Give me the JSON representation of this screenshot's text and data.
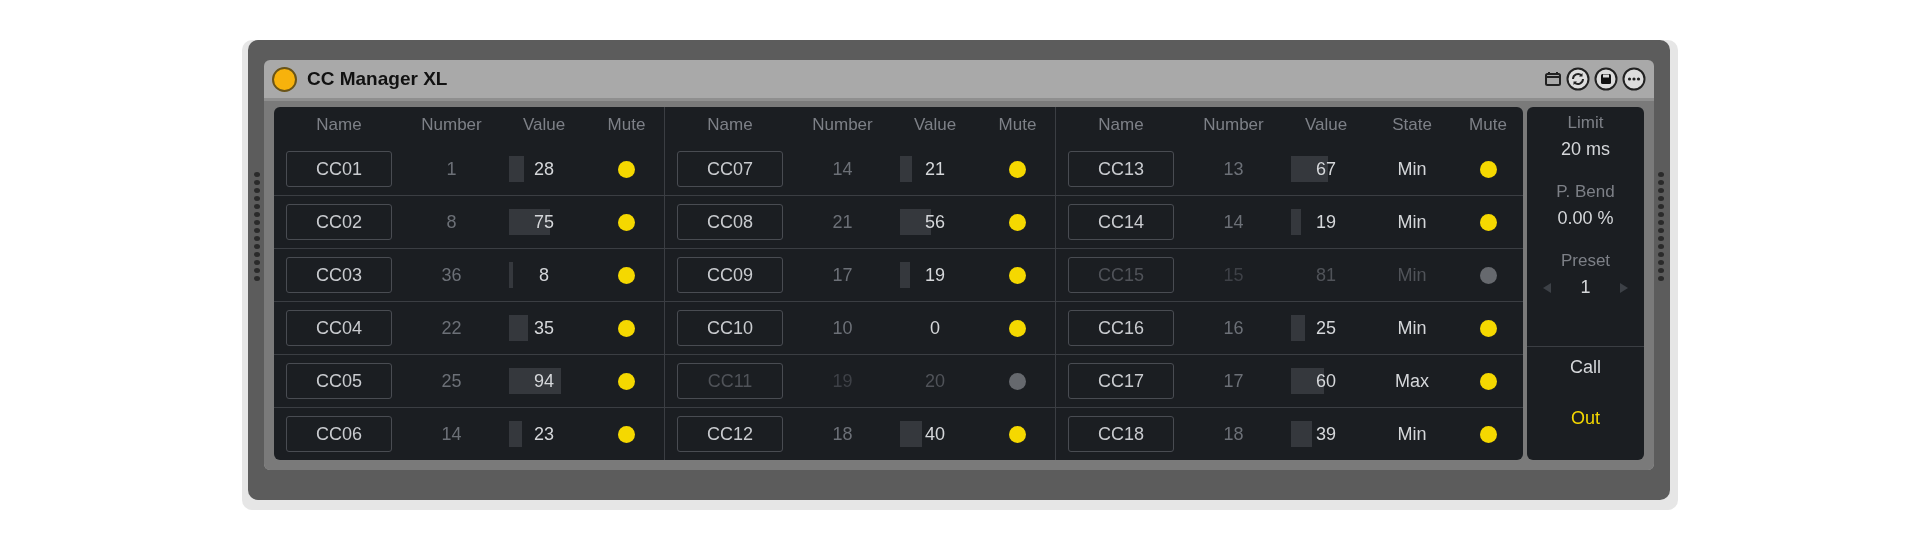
{
  "window": {
    "title": "CC Manager XL",
    "power_on": true
  },
  "sections": [
    {
      "columns": [
        "Name",
        "Number",
        "Value",
        "Mute"
      ],
      "rows": [
        {
          "name": "CC01",
          "number": "1",
          "value": "28",
          "active": true
        },
        {
          "name": "CC02",
          "number": "8",
          "value": "75",
          "active": true
        },
        {
          "name": "CC03",
          "number": "36",
          "value": "8",
          "active": true
        },
        {
          "name": "CC04",
          "number": "22",
          "value": "35",
          "active": true
        },
        {
          "name": "CC05",
          "number": "25",
          "value": "94",
          "active": true
        },
        {
          "name": "CC06",
          "number": "14",
          "value": "23",
          "active": true
        }
      ]
    },
    {
      "columns": [
        "Name",
        "Number",
        "Value",
        "Mute"
      ],
      "rows": [
        {
          "name": "CC07",
          "number": "14",
          "value": "21",
          "active": true
        },
        {
          "name": "CC08",
          "number": "21",
          "value": "56",
          "active": true
        },
        {
          "name": "CC09",
          "number": "17",
          "value": "19",
          "active": true
        },
        {
          "name": "CC10",
          "number": "10",
          "value": "0",
          "active": true
        },
        {
          "name": "CC11",
          "number": "19",
          "value": "20",
          "active": false
        },
        {
          "name": "CC12",
          "number": "18",
          "value": "40",
          "active": true
        }
      ]
    },
    {
      "columns": [
        "Name",
        "Number",
        "Value",
        "State",
        "Mute"
      ],
      "rows": [
        {
          "name": "CC13",
          "number": "13",
          "value": "67",
          "state": "Min",
          "active": true
        },
        {
          "name": "CC14",
          "number": "14",
          "value": "19",
          "state": "Min",
          "active": true
        },
        {
          "name": "CC15",
          "number": "15",
          "value": "81",
          "state": "Min",
          "active": false
        },
        {
          "name": "CC16",
          "number": "16",
          "value": "25",
          "state": "Min",
          "active": true
        },
        {
          "name": "CC17",
          "number": "17",
          "value": "60",
          "state": "Max",
          "active": true
        },
        {
          "name": "CC18",
          "number": "18",
          "value": "39",
          "state": "Min",
          "active": true
        }
      ]
    }
  ],
  "side_panel": {
    "limit": {
      "label": "Limit",
      "value": "20 ms"
    },
    "pitch_bend": {
      "label": "P. Bend",
      "value": "0.00 %"
    },
    "preset": {
      "label": "Preset",
      "value": "1"
    },
    "buttons": [
      {
        "label": "Call",
        "on": false
      },
      {
        "label": "Out",
        "on": true
      }
    ]
  }
}
